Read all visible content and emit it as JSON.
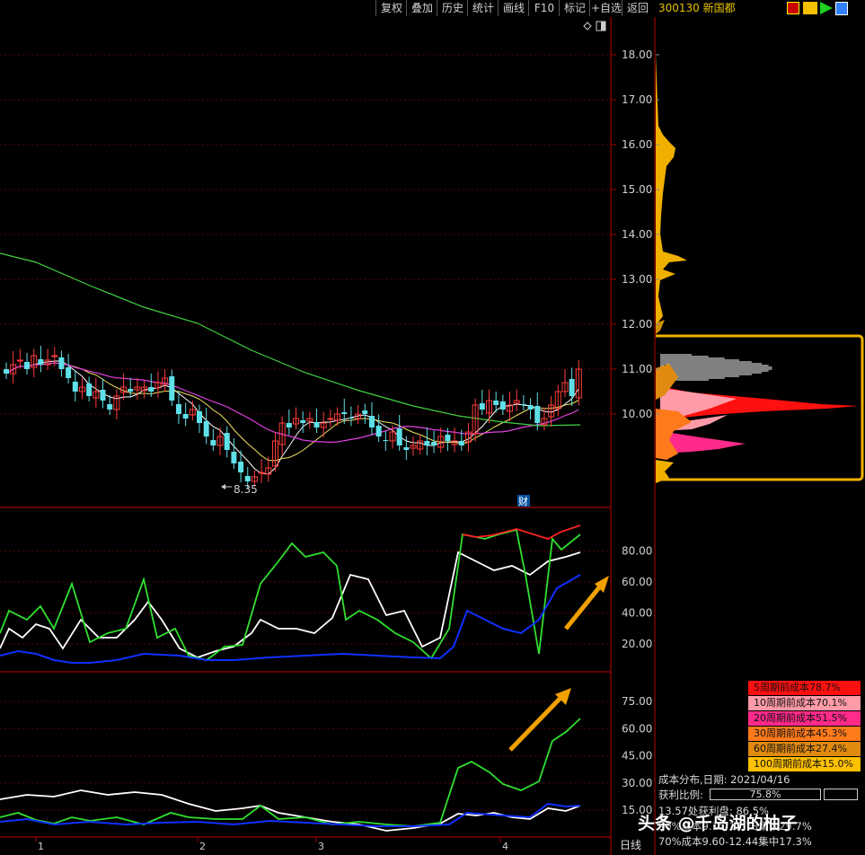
{
  "toolbar": {
    "buttons": [
      "复权",
      "叠加",
      "历史",
      "统计",
      "画线",
      "F10",
      "标记",
      "+自选",
      "返回"
    ]
  },
  "stock": {
    "code_name": "300130 新国都"
  },
  "main_chart": {
    "y_ticks": [
      "18.00",
      "17.00",
      "16.00",
      "15.00",
      "14.00",
      "13.00",
      "12.00",
      "11.00",
      "10.00"
    ],
    "low_label": "8.35",
    "fin_badge": "财"
  },
  "indicator1": {
    "y_ticks": [
      "80.00",
      "60.00",
      "40.00",
      "20.00"
    ]
  },
  "indicator2": {
    "y_ticks": [
      "75.00",
      "60.00",
      "45.00",
      "30.00",
      "15.00"
    ]
  },
  "x_axis": {
    "labels": [
      "1",
      "2",
      "3",
      "4"
    ]
  },
  "timeframe": "日线",
  "chip_legend": [
    {
      "label": "5周期前成本78.7%",
      "color": "#ff1010"
    },
    {
      "label": "10周期前成本70.1%",
      "color": "#ff9aa8"
    },
    {
      "label": "20周期前成本51.5%",
      "color": "#ff2a8a"
    },
    {
      "label": "30周期前成本45.3%",
      "color": "#ff7a1a"
    },
    {
      "label": "60周期前成本27.4%",
      "color": "#e08a10"
    },
    {
      "label": "100周期前成本15.0%",
      "color": "#ffc000"
    }
  ],
  "chip_info": {
    "distribution_date": "成本分布,日期: 2021/04/16",
    "profit_ratio_label": "获利比例:",
    "profit_ratio_value": "75.8%",
    "profit_ratio_fraction": 0.758,
    "line1": "13.57处获利盘: 86.5%",
    "line2": "90%成本9.15-15.78集中29.7%",
    "line3": "70%成本9.60-12.44集中17.3%"
  },
  "watermark": "头条 @千岛湖的柚子"
}
